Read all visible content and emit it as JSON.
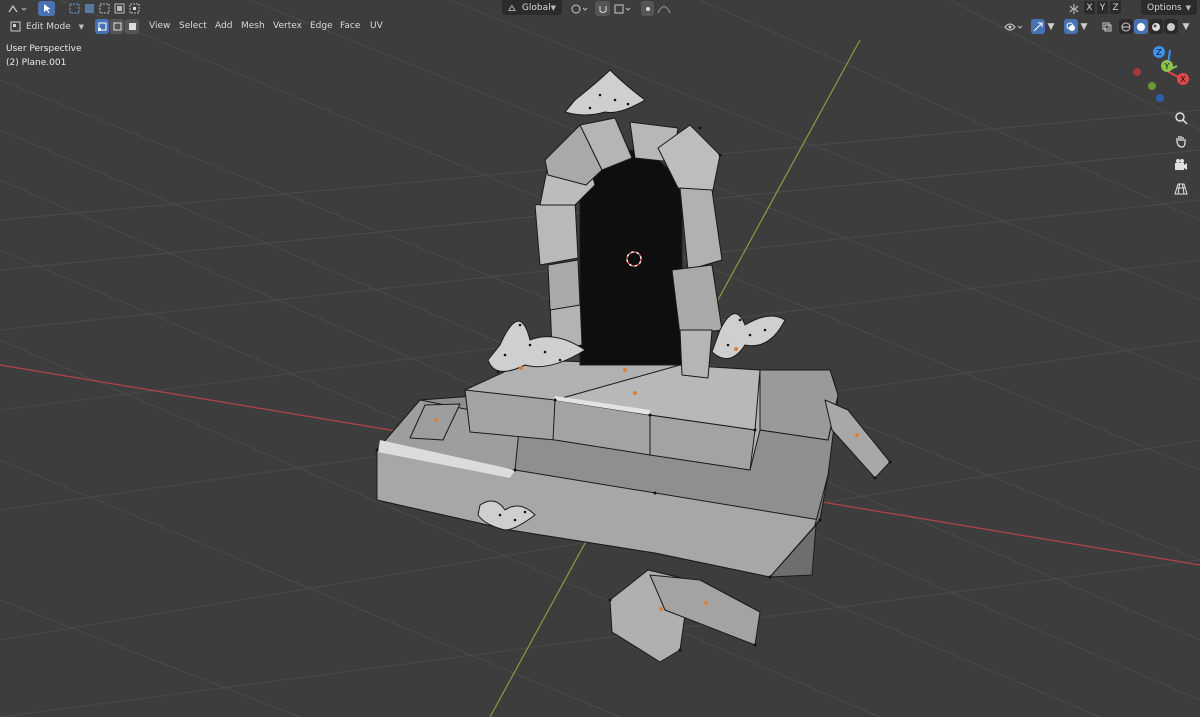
{
  "header": {
    "mode_dropdown": "Edit Mode",
    "menus": [
      "View",
      "Select",
      "Add",
      "Mesh",
      "Vertex",
      "Edge",
      "Face",
      "UV"
    ],
    "transform_orientation": "Global",
    "options_label": "Options",
    "mirror_axes": [
      "X",
      "Y",
      "Z"
    ]
  },
  "overlay": {
    "view_name": "User Perspective",
    "object_name": "(2) Plane.001"
  },
  "gizmo": {
    "axes": [
      {
        "label": "Y",
        "color": "#8bc34a"
      },
      {
        "label": "X",
        "color": "#e04848"
      },
      {
        "label": "Z",
        "color": "#3d8ff0"
      }
    ]
  },
  "nav_tools": [
    "zoom-icon",
    "hand-pan-icon",
    "camera-icon",
    "perspective-grid-icon"
  ],
  "colors": {
    "viewport_bg": "#3d3d3d",
    "grid": "#4a4a4a",
    "x_axis": "#c44a4a",
    "y_axis": "#8ca44a",
    "mesh_face": "#9c9c9c",
    "mesh_dark": "#0e0e0e",
    "accent": "#4772b3"
  }
}
